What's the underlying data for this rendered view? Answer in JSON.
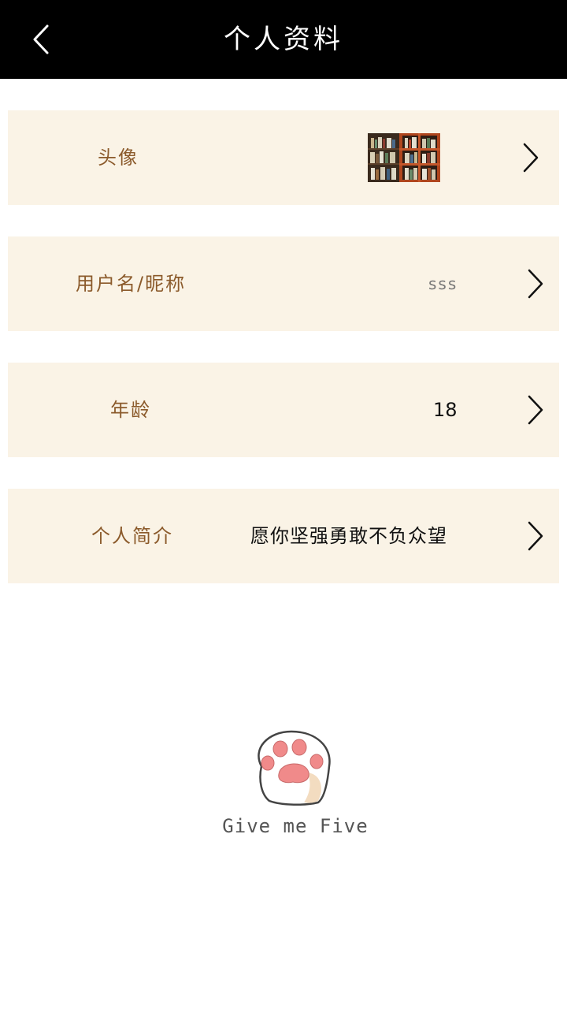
{
  "header": {
    "title": "个人资料",
    "back_icon": "chevron-left-icon"
  },
  "rows": [
    {
      "label": "头像",
      "value_type": "image",
      "value_icon": "bookshelf-avatar-image",
      "chevron_icon": "chevron-right-icon"
    },
    {
      "label": "用户名/昵称",
      "value": "sss",
      "chevron_icon": "chevron-right-icon"
    },
    {
      "label": "年龄",
      "value": "18",
      "chevron_icon": "chevron-right-icon"
    },
    {
      "label": "个人简介",
      "value": "愿你坚强勇敢不负众望",
      "chevron_icon": "chevron-right-icon"
    }
  ],
  "illustration": {
    "icon": "cat-paw-icon",
    "caption": "Give me Five"
  },
  "colors": {
    "header_bg": "#000000",
    "row_bg": "#faf3e6",
    "label_color": "#8b5a2b",
    "paw_pad": "#f08a8a"
  }
}
